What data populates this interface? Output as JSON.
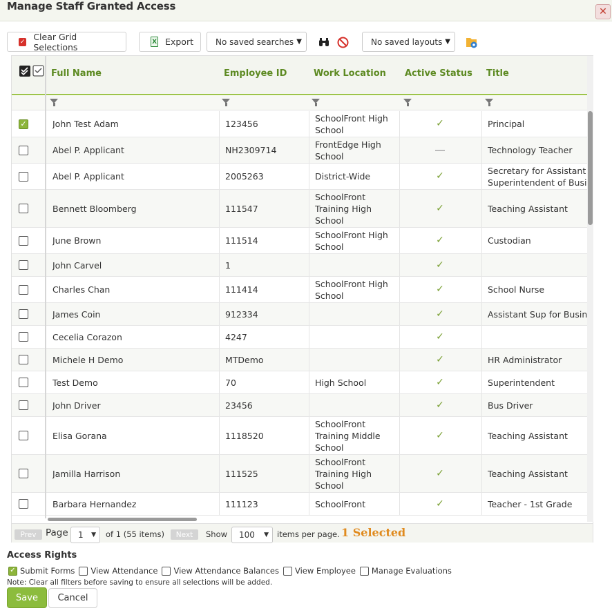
{
  "window": {
    "title": "Manage Staff Granted Access",
    "close_icon": "close-icon"
  },
  "toolbar": {
    "clear_label": "Clear Grid Selections",
    "export_label": "Export",
    "saved_searches": "No saved searches",
    "saved_layouts": "No saved layouts",
    "icons": [
      "checkbox-red-icon",
      "excel-icon",
      "binoculars-icon",
      "no-entry-icon",
      "layout-gear-icon"
    ]
  },
  "grid": {
    "columns": [
      "Full Name",
      "Employee ID",
      "Work Location",
      "Active Status",
      "Title"
    ],
    "rows": [
      {
        "checked": true,
        "name": "John Test Adam",
        "id": "123456",
        "location": [
          "SchoolFront High",
          "School"
        ],
        "active": true,
        "title": [
          "Principal"
        ]
      },
      {
        "checked": false,
        "name": "Abel P. Applicant",
        "id": "NH2309714",
        "location": [
          "FrontEdge High",
          "School"
        ],
        "active": false,
        "title": [
          "Technology Teacher"
        ]
      },
      {
        "checked": false,
        "name": "Abel P. Applicant",
        "id": "2005263",
        "location": [
          "District-Wide"
        ],
        "active": true,
        "title": [
          "Secretary for Assistant",
          "Superintendent of Busine"
        ]
      },
      {
        "checked": false,
        "name": "Bennett Bloomberg",
        "id": "111547",
        "location": [
          "SchoolFront",
          "Training High",
          "School"
        ],
        "active": true,
        "title": [
          "Teaching Assistant"
        ]
      },
      {
        "checked": false,
        "name": "June Brown",
        "id": "111514",
        "location": [
          "SchoolFront High",
          "School"
        ],
        "active": true,
        "title": [
          "Custodian"
        ]
      },
      {
        "checked": false,
        "name": "John Carvel",
        "id": "1",
        "location": [],
        "active": true,
        "title": []
      },
      {
        "checked": false,
        "name": "Charles Chan",
        "id": "111414",
        "location": [
          "SchoolFront High",
          "School"
        ],
        "active": true,
        "title": [
          "School Nurse"
        ]
      },
      {
        "checked": false,
        "name": "James Coin",
        "id": "912334",
        "location": [],
        "active": true,
        "title": [
          "Assistant Sup for Business"
        ]
      },
      {
        "checked": false,
        "name": "Cecelia Corazon",
        "id": "4247",
        "location": [],
        "active": true,
        "title": []
      },
      {
        "checked": false,
        "name": "Michele H Demo",
        "id": "MTDemo",
        "location": [],
        "active": true,
        "title": [
          "HR Administrator"
        ]
      },
      {
        "checked": false,
        "name": "Test Demo",
        "id": "70",
        "location": [
          "High School"
        ],
        "active": true,
        "title": [
          "Superintendent"
        ]
      },
      {
        "checked": false,
        "name": "John Driver",
        "id": "23456",
        "location": [],
        "active": true,
        "title": [
          "Bus Driver"
        ]
      },
      {
        "checked": false,
        "name": "Elisa Gorana",
        "id": "1118520",
        "location": [
          "SchoolFront",
          "Training Middle",
          "School"
        ],
        "active": true,
        "title": [
          "Teaching Assistant"
        ]
      },
      {
        "checked": false,
        "name": "Jamilla Harrison",
        "id": "111525",
        "location": [
          "SchoolFront",
          "Training High",
          "School"
        ],
        "active": true,
        "title": [
          "Teaching Assistant"
        ]
      },
      {
        "checked": false,
        "name": "Barbara Hernandez",
        "id": "111123",
        "location": [
          "SchoolFront"
        ],
        "active": true,
        "title": [
          "Teacher - 1st Grade"
        ]
      }
    ]
  },
  "pager": {
    "prev": "Prev",
    "page_label": "Page",
    "page_value": "1",
    "of_text": "of 1 (55 items)",
    "next": "Next",
    "show_label": "Show",
    "per_page_value": "100",
    "per_page_label": "items per page.",
    "selected": "1 Selected"
  },
  "access": {
    "title": "Access Rights",
    "options": [
      {
        "label": "Submit Forms",
        "checked": true
      },
      {
        "label": "View Attendance",
        "checked": false
      },
      {
        "label": "View Attendance Balances",
        "checked": false
      },
      {
        "label": "View Employee",
        "checked": false
      },
      {
        "label": "Manage Evaluations",
        "checked": false
      }
    ],
    "note": "Note: Clear all filters before saving to ensure all selections will be added."
  },
  "buttons": {
    "save": "Save",
    "cancel": "Cancel"
  },
  "colors": {
    "accent": "#8cbc3d",
    "header_text": "#5d8a22",
    "selected_count": "#e08a1e"
  }
}
